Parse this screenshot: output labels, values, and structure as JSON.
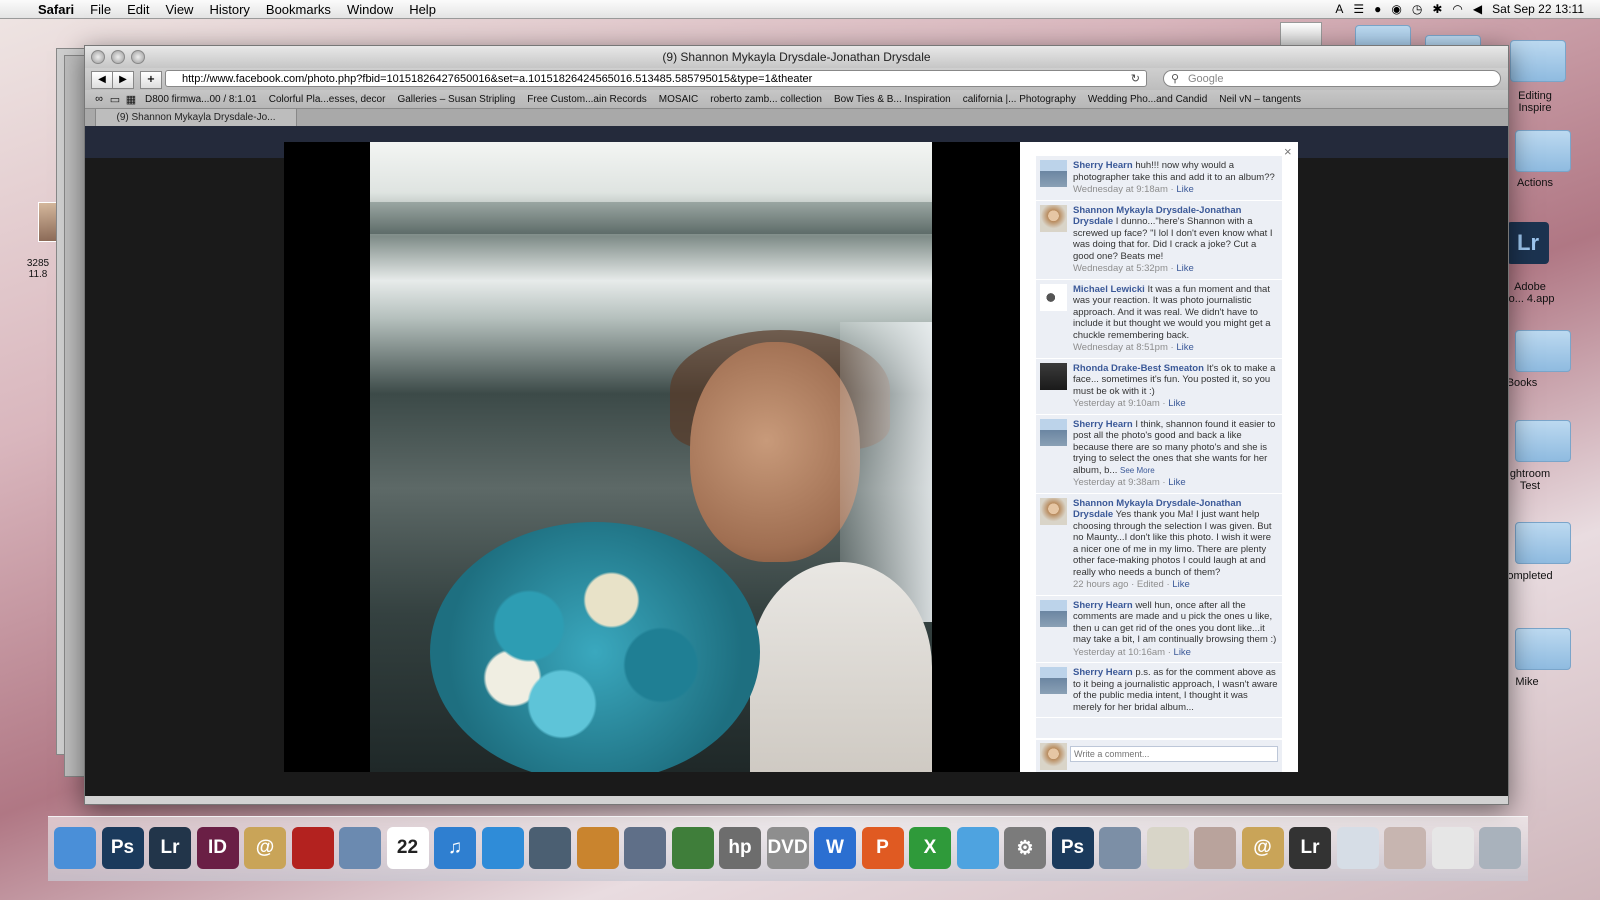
{
  "menubar": {
    "app": "Safari",
    "items": [
      "File",
      "Edit",
      "View",
      "History",
      "Bookmarks",
      "Window",
      "Help"
    ],
    "clock": "Sat Sep 22  13:11"
  },
  "desktop": {
    "labels": [
      "Editing\nInspire",
      "Actions",
      "Adobe\nto... 4.app",
      "Books",
      "ghtroom\nTest",
      "ompleted",
      "Mike"
    ],
    "left_file": "3285\n11.8"
  },
  "window": {
    "title": "(9) Shannon Mykayla Drysdale-Jonathan Drysdale",
    "url": "http://www.facebook.com/photo.php?fbid=10151826427650016&set=a.10151826424565016.513485.585795015&type=1&theater",
    "search_placeholder": "Google",
    "bookmarks": [
      "D800 firmwa...00 / 8:1.01",
      "Colorful Pla...esses, decor",
      "Galleries – Susan Stripling",
      "Free Custom...ain Records",
      "MOSAIC",
      "roberto zamb... collection",
      "Bow Ties & B... Inspiration",
      "california |... Photography",
      "Wedding Pho...and Candid",
      "Neil vN – tangents"
    ],
    "tab_title": "(9) Shannon Mykayla Drysdale-Jo..."
  },
  "comments": [
    {
      "name": "Sherry Hearn",
      "text": "huh!!! now why would a photographer take this and add it to an album??",
      "time": "Wednesday at 9:18am",
      "sep": " · ",
      "like": "Like",
      "avatar": "sh"
    },
    {
      "name": "Shannon Mykayla Drysdale-Jonathan Drysdale",
      "text": "I dunno...\"here's Shannon with a screwed up face? \"I lol I don't even know what I was doing that for. Did I crack a joke? Cut a good one? Beats me!",
      "time": "Wednesday at 5:32pm",
      "sep": " · ",
      "like": "Like",
      "avatar": "sm"
    },
    {
      "name": "Michael Lewicki",
      "text": "It was a fun moment and that was your reaction. It was photo journalistic approach. And it was real. We didn't have to include it but thought we would you might get a chuckle remembering back.",
      "time": "Wednesday at 8:51pm",
      "sep": " · ",
      "like": "Like",
      "avatar": "ml"
    },
    {
      "name": "Rhonda Drake-Best Smeaton",
      "text": "It's ok to make a face... sometimes it's fun. You posted it, so you must be ok with it :)",
      "time": "Yesterday at 9:10am",
      "sep": " · ",
      "like": "Like",
      "avatar": "rd"
    },
    {
      "name": "Sherry Hearn",
      "text": "I think, shannon found it easier to post all the photo's good and back a like because there are so many photo's and she is trying to select the ones that she wants for her album, b...",
      "see_more": "See More",
      "time": "Yesterday at 9:38am",
      "sep": " · ",
      "like": "Like",
      "avatar": "sh"
    },
    {
      "name": "Shannon Mykayla Drysdale-Jonathan Drysdale",
      "text": "Yes thank you Ma! I just want help choosing through the selection I was given. But no Maunty...I don't like this photo. I wish it were a nicer one of me in my limo. There are plenty other face-making photos I could laugh at and really who needs a bunch of them?",
      "time": "22 hours ago · Edited",
      "sep": " · ",
      "like": "Like",
      "avatar": "sm"
    },
    {
      "name": "Sherry Hearn",
      "text": "well hun, once after all the comments are made and u pick the ones u like, then u can get rid of the ones you dont like...it may take a bit, I am continually browsing them :)",
      "time": "Yesterday at 10:16am",
      "sep": " · ",
      "like": "Like",
      "avatar": "sh"
    },
    {
      "name": "Sherry Hearn",
      "text": "p.s. as for the comment above as to it being a journalistic approach, I wasn't aware of the public media intent, I thought it was merely for her bridal album...",
      "time": "",
      "sep": "",
      "like": "",
      "avatar": "sh"
    }
  ],
  "comment_box": {
    "placeholder": "Write a comment..."
  },
  "close_glyph": "×",
  "dock": [
    {
      "icon": "finder-icon",
      "label": "",
      "color": "#4a8fd8"
    },
    {
      "icon": "photoshop-icon",
      "label": "Ps",
      "color": "#1b3a5c"
    },
    {
      "icon": "lightroom-icon",
      "label": "Lr",
      "color": "#22354a"
    },
    {
      "icon": "indesign-icon",
      "label": "ID",
      "color": "#6a1f45"
    },
    {
      "icon": "address-book-icon",
      "label": "@",
      "color": "#c9a458"
    },
    {
      "icon": "photo-booth-icon",
      "label": "",
      "color": "#b3221f"
    },
    {
      "icon": "iphoto-icon",
      "label": "",
      "color": "#6b8ab0"
    },
    {
      "icon": "calendar-icon",
      "label": "22",
      "color": "#ffffff"
    },
    {
      "icon": "itunes-icon",
      "label": "♫",
      "color": "#2f7fd0"
    },
    {
      "icon": "safari-icon",
      "label": "",
      "color": "#2f8cd8"
    },
    {
      "icon": "time-machine-icon",
      "label": "",
      "color": "#4b5f72"
    },
    {
      "icon": "keynote-icon",
      "label": "",
      "color": "#c9842e"
    },
    {
      "icon": "pen-icon",
      "label": "",
      "color": "#5f6f88"
    },
    {
      "icon": "numbers-icon",
      "label": "",
      "color": "#3f7e3a"
    },
    {
      "icon": "hp-icon",
      "label": "hp",
      "color": "#6d6d6d"
    },
    {
      "icon": "dvd-player-icon",
      "label": "DVD",
      "color": "#8e8e8e"
    },
    {
      "icon": "word-icon",
      "label": "W",
      "color": "#2b6fd1"
    },
    {
      "icon": "powerpoint-icon",
      "label": "P",
      "color": "#e05a22"
    },
    {
      "icon": "excel-icon",
      "label": "X",
      "color": "#2f9a3a"
    },
    {
      "icon": "messenger-icon",
      "label": "",
      "color": "#4ea3e0"
    },
    {
      "icon": "system-preferences-icon",
      "label": "⚙",
      "color": "#7b7b7b"
    },
    {
      "icon": "photoshop-icon-2",
      "label": "Ps",
      "color": "#1b3a5c"
    },
    {
      "icon": "preview-icon",
      "label": "",
      "color": "#7c8fa6"
    },
    {
      "icon": "textedit-icon",
      "label": "",
      "color": "#d8d5c8"
    },
    {
      "icon": "photo-stack-icon",
      "label": "",
      "color": "#b9a39c"
    },
    {
      "icon": "address-book-icon-2",
      "label": "@",
      "color": "#c9a458"
    },
    {
      "icon": "window-lightroom-icon",
      "label": "Lr",
      "color": "#333"
    },
    {
      "icon": "window-safari-icon",
      "label": "",
      "color": "#d6dde6"
    },
    {
      "icon": "window-photo-icon",
      "label": "",
      "color": "#c7b5b0"
    },
    {
      "icon": "window-blank-icon",
      "label": "",
      "color": "#e6e6e6"
    },
    {
      "icon": "trash-icon",
      "label": "",
      "color": "#a9b2bc"
    }
  ]
}
